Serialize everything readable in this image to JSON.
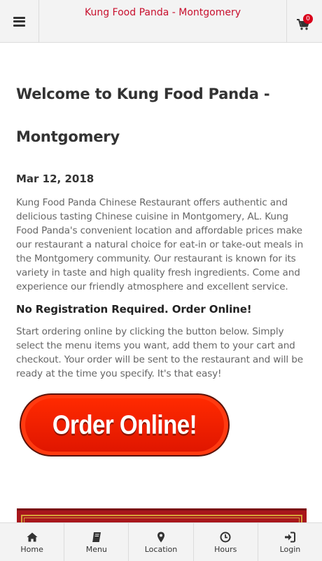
{
  "header": {
    "title": "Kung Food Panda - Montgomery",
    "menu_icon": "hamburger-icon",
    "cart_icon": "shopping-cart-icon",
    "cart_count": "0"
  },
  "main": {
    "heading": "Welcome to Kung Food Panda - Montgomery",
    "date": "Mar 12, 2018",
    "intro": "Kung Food Panda Chinese Restaurant offers authentic and delicious tasting Chinese cuisine in Montgomery, AL.  Kung Food Panda's convenient location and affordable prices make our restaurant a natural choice for eat-in or take-out meals in the Montgomery community. Our restaurant is known for its variety in taste and high quality fresh ingredients. Come and experience our friendly atmosphere and excellent service.",
    "subheading": "No Registration Required. Order Online!",
    "instructions": "Start ordering online by clicking the button below. Simply select the menu items you want, add them to your cart and checkout. Your order will be sent to the restaurant and will be ready at the time you specify. It's that easy!",
    "order_button": "Order Online!"
  },
  "footer": {
    "items": [
      {
        "label": "Home",
        "icon": "home-icon"
      },
      {
        "label": "Menu",
        "icon": "book-icon"
      },
      {
        "label": "Location",
        "icon": "map-marker-icon"
      },
      {
        "label": "Hours",
        "icon": "clock-icon"
      },
      {
        "label": "Login",
        "icon": "sign-in-icon"
      }
    ]
  },
  "colors": {
    "title": "#c8102e",
    "badge": "#d9001b",
    "order_button": "#ff2a00",
    "banner": "#a8161c"
  }
}
